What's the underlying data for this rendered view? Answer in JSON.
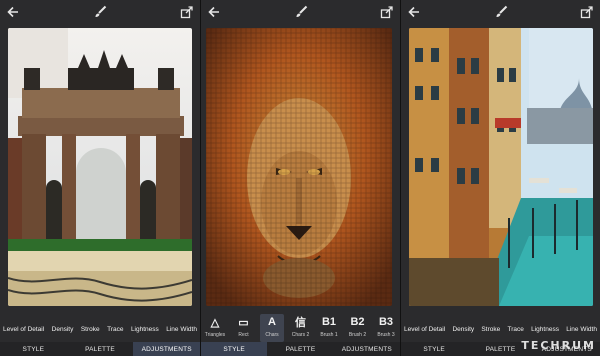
{
  "screens": [
    {
      "artwork": "Arch of Peace painted in impressionist style",
      "tools": [
        "Level of Detail",
        "Density",
        "Stroke",
        "Trace",
        "Lightness",
        "Line Width"
      ],
      "tabs": [
        "STYLE",
        "PALETTE",
        "ADJUSTMENTS"
      ],
      "active_tab": "ADJUSTMENTS"
    },
    {
      "artwork": "Lion portrait rendered with character mosaic",
      "brushes": [
        {
          "glyph": "△",
          "label": "Triangles"
        },
        {
          "glyph": "▭",
          "label": "Rect"
        },
        {
          "glyph": "A",
          "label": "Chars"
        },
        {
          "glyph": "信",
          "label": "Chars 2"
        },
        {
          "glyph": "B1",
          "label": "Brush 1"
        },
        {
          "glyph": "B2",
          "label": "Brush 2"
        },
        {
          "glyph": "B3",
          "label": "Brush 3"
        }
      ],
      "selected_brush": "Chars",
      "tabs": [
        "STYLE",
        "PALETTE",
        "ADJUSTMENTS"
      ],
      "active_tab": "STYLE"
    },
    {
      "artwork": "Venice canal painted in impressionist style",
      "tools": [
        "Level of Detail",
        "Density",
        "Stroke",
        "Trace",
        "Lightness",
        "Line Width"
      ],
      "tabs": [
        "STYLE",
        "PALETTE",
        "ADJUSTMENTS"
      ]
    }
  ],
  "icons": [
    "back-arrow-icon",
    "brush-icon",
    "share-icon"
  ],
  "colors": {
    "background": "#2b2b2d",
    "active_tab": "#394152",
    "text": "#f0f0f0"
  },
  "watermark": "TECHRUM"
}
